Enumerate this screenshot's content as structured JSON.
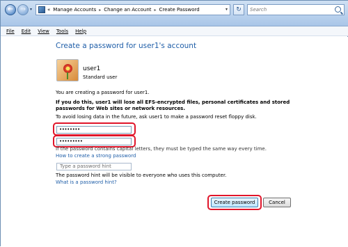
{
  "window": {
    "breadcrumb_start": "«",
    "breadcrumbs": [
      "Manage Accounts",
      "Change an Account",
      "Create Password"
    ],
    "search_placeholder": "Search"
  },
  "menu": [
    "File",
    "Edit",
    "View",
    "Tools",
    "Help"
  ],
  "page": {
    "title": "Create a password for user1's account",
    "user_name": "user1",
    "user_role": "Standard user",
    "intro": "You are creating a password for user1.",
    "warning": "If you do this, user1 will lose all EFS-encrypted files, personal certificates and stored passwords for Web sites or network resources.",
    "advice": "To avoid losing data in the future, ask user1 to make a password reset floppy disk.",
    "new_password_value": "••••••••",
    "confirm_password_value": "•••••••••",
    "case_note": "If the password contains capital letters, they must be typed the same way every time.",
    "strong_password_link": "How to create a strong password",
    "hint_placeholder": "Type a password hint",
    "hint_note": "The password hint will be visible to everyone who uses this computer.",
    "hint_link": "What is a password hint?",
    "create_button": "Create password",
    "cancel_button": "Cancel"
  },
  "colors": {
    "link": "#1f5ea8",
    "callout": "#e0152a",
    "toolbar_top": "#cfe0f3",
    "toolbar_bottom": "#a9c6e8"
  }
}
